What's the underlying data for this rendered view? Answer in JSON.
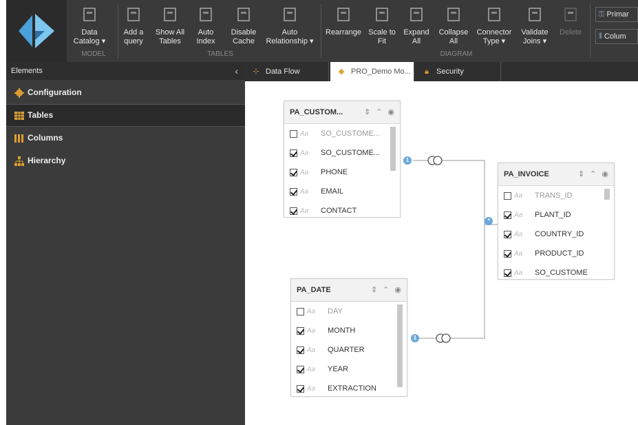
{
  "colors": {
    "ribbon": "#3a3a3a",
    "panel": "#3b3b3b",
    "accent": "#6aa8dc",
    "gold": "#e0a030"
  },
  "ribbon": {
    "buttons": [
      {
        "label": "Data\nCatalog ▾",
        "icon": "data-catalog-icon"
      },
      {
        "label": "Add a\nquery",
        "icon": "add-query-icon"
      },
      {
        "label": "Show All\nTables",
        "icon": "show-tables-icon"
      },
      {
        "label": "Auto\nIndex",
        "icon": "auto-index-icon"
      },
      {
        "label": "Disable\nCache",
        "icon": "disable-cache-icon"
      },
      {
        "label": "Auto\nRelationship ▾",
        "icon": "auto-relationship-icon"
      },
      {
        "label": "Rearrange",
        "icon": "rearrange-icon"
      },
      {
        "label": "Scale to\nFit",
        "icon": "scale-fit-icon"
      },
      {
        "label": "Expand\nAll",
        "icon": "expand-icon"
      },
      {
        "label": "Collapse\nAll",
        "icon": "collapse-icon"
      },
      {
        "label": "Connector\nType ▾",
        "icon": "connector-icon"
      },
      {
        "label": "Validate\nJoins ▾",
        "icon": "validate-icon"
      },
      {
        "label": "Delete",
        "icon": "delete-icon"
      }
    ],
    "groups": {
      "model": "MODEL",
      "tables": "TABLES",
      "diagram": "DIAGRAM"
    },
    "side_buttons": {
      "primary": "Primar",
      "columns": "Colum"
    }
  },
  "left_panel": {
    "title": "Elements",
    "collapse": "‹",
    "items": [
      {
        "label": "Configuration"
      },
      {
        "label": "Tables"
      },
      {
        "label": "Columns"
      },
      {
        "label": "Hierarchy"
      }
    ]
  },
  "tabs": [
    {
      "label": "Data Flow"
    },
    {
      "label": "PRO_Demo Mo..."
    },
    {
      "label": "Security"
    }
  ],
  "tables": {
    "customer": {
      "title": "PA_CUSTOM...",
      "columns": [
        {
          "name": "SO_CUSTOME...",
          "checked": false
        },
        {
          "name": "SO_CUSTOME...",
          "checked": true
        },
        {
          "name": "PHONE",
          "checked": true
        },
        {
          "name": "EMAIL",
          "checked": true
        },
        {
          "name": "CONTACT",
          "checked": true
        }
      ]
    },
    "invoice": {
      "title": "PA_INVOICE",
      "columns": [
        {
          "name": "TRANS_ID",
          "checked": false
        },
        {
          "name": "PLANT_ID",
          "checked": true
        },
        {
          "name": "COUNTRY_ID",
          "checked": true
        },
        {
          "name": "PRODUCT_ID",
          "checked": true
        },
        {
          "name": "SO_CUSTOME",
          "checked": true
        }
      ]
    },
    "date": {
      "title": "PA_DATE",
      "columns": [
        {
          "name": "DAY",
          "checked": false
        },
        {
          "name": "MONTH",
          "checked": true
        },
        {
          "name": "QUARTER",
          "checked": true
        },
        {
          "name": "YEAR",
          "checked": true
        },
        {
          "name": "EXTRACTION",
          "checked": true
        }
      ]
    }
  },
  "aa": "Aa",
  "badges": {
    "one": "1",
    "many": "*"
  }
}
